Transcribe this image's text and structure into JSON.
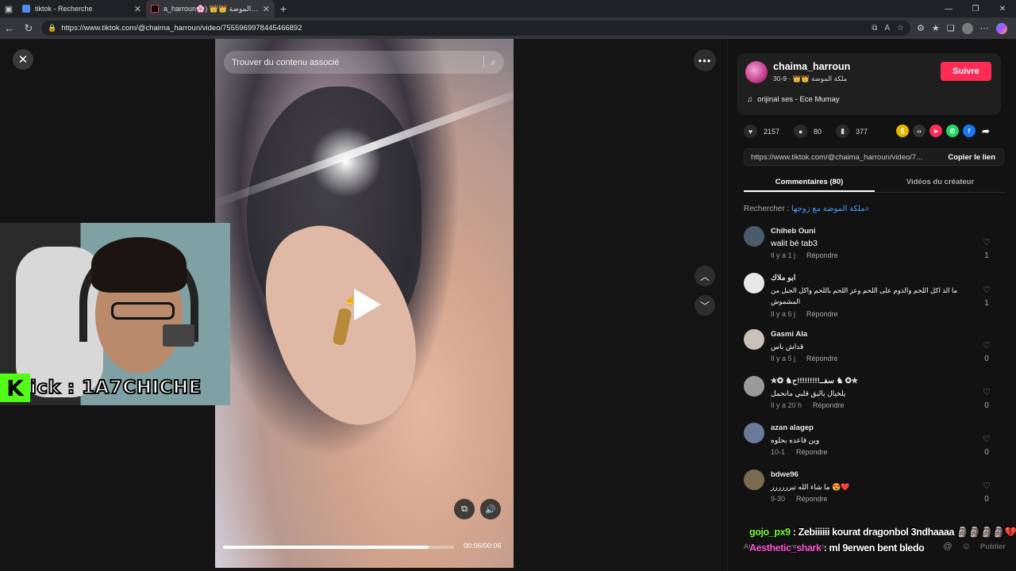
{
  "browser": {
    "tabs": [
      {
        "title": "tiktok - Recherche",
        "active": false
      },
      {
        "title": "a_harroun🌸) 👑👑 ملكة الموضة",
        "active": true
      }
    ],
    "url": "https://www.tiktok.com/@chaima_harroun/video/7555969978445466892"
  },
  "video": {
    "search_placeholder": "Trouver du contenu associé",
    "time": "00:06/00:06",
    "progress_fraction": 0.89
  },
  "stream_overlay": {
    "kick_letter": "K",
    "kick_text": "ick : 1A7CHICHE"
  },
  "creator": {
    "username": "chaima_harroun",
    "subtitle": "ملكة الموضة 👑👑 · 9-30",
    "follow_label": "Suivre",
    "music": "orijinal ses - Ece Mumay"
  },
  "stats": {
    "likes": "2157",
    "comments": "80",
    "saves": "377"
  },
  "link": {
    "url": "https://www.tiktok.com/@chaima_harroun/video/7...",
    "copy_label": "Copier le lien"
  },
  "tabs": {
    "comments": "Commentaires (80)",
    "creator_videos": "Vidéos du créateur"
  },
  "related_search": {
    "label": "Rechercher : ",
    "query": "ملكة الموضة مع زوجها"
  },
  "comments": [
    {
      "user": "Chiheb Ouni",
      "text": "walit bé tab3",
      "time": "Il y a 1 j",
      "reply": "Répondre",
      "likes": "1"
    },
    {
      "user": "ابو ملاك",
      "text": "ما الذ اكل اللحم والذوم على اللحم وعز اللحم باللحم واكل الجبل من المشموش",
      "time": "Il y a 6 j",
      "reply": "Répondre",
      "likes": "1"
    },
    {
      "user": "Gasmi Ala",
      "text": "قداش باس",
      "time": "Il y a 5 j",
      "reply": "Répondre",
      "likes": "0"
    },
    {
      "user": "✮✪ ♞سفــ!!!!!!!!!ح ♞ ✪✮",
      "text": "يلخيال ياليق قلبي مانحمل",
      "time": "Il y a 20 h",
      "reply": "Répondre",
      "likes": "0"
    },
    {
      "user": "azan alagep",
      "text": "وين قاعده بحلوه",
      "time": "10-1",
      "reply": "Répondre",
      "likes": "0"
    },
    {
      "user": "bdwe96",
      "text": "ما شاء الله تبرررررر 😍❤️",
      "time": "9-30",
      "reply": "Répondre",
      "likes": "0"
    }
  ],
  "add_comment": {
    "placeholder": "Ajouter un commentaire...",
    "publish": "Publier"
  },
  "chat": [
    {
      "user": "gojo_px9",
      "message": "Zebiiiiii kourat dragonbol 3ndhaaaa 🗿🗿🗿🗿💔💔"
    },
    {
      "user": "Aesthetic_shark",
      "message": "ml 9erwen bent bledo"
    }
  ]
}
